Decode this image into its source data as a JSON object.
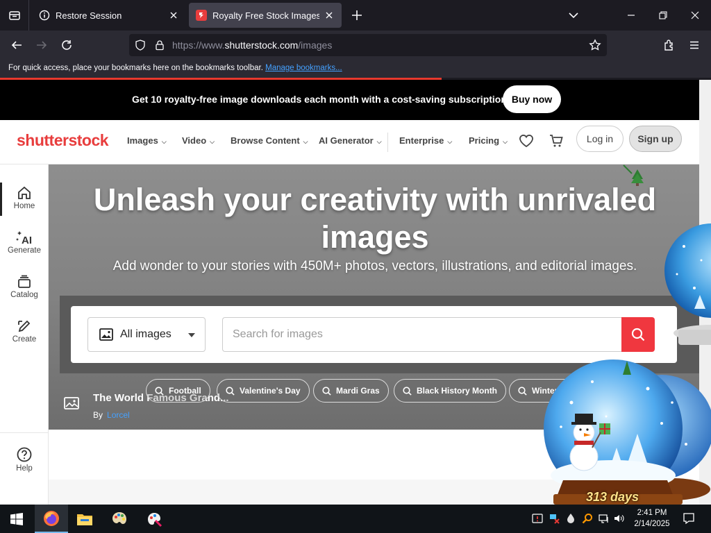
{
  "browser": {
    "tabs": [
      {
        "label": "Restore Session",
        "active": false
      },
      {
        "label": "Royalty Free Stock Images For C",
        "active": true
      }
    ],
    "url_prefix": "https://www.",
    "url_host": "shutterstock.com",
    "url_path": "/images",
    "bookmarks_hint": "For quick access, place your bookmarks here on the bookmarks toolbar.",
    "bookmarks_link": "Manage bookmarks..."
  },
  "promo": {
    "text": "Get 10 royalty-free image downloads each month with a cost-saving subscription.",
    "button": "Buy now"
  },
  "header": {
    "logo": "shutterstock",
    "menu": [
      "Images",
      "Video",
      "Browse Content",
      "AI Generator",
      "Enterprise",
      "Pricing"
    ],
    "login": "Log in",
    "signup": "Sign up"
  },
  "sidebar": {
    "items": [
      "Home",
      "Generate",
      "Catalog",
      "Create"
    ],
    "help": "Help"
  },
  "hero": {
    "title": "Unleash your creativity with unrivaled images",
    "subtitle": "Add wonder to your stories with 450M+ photos, vectors, illustrations, and editorial images.",
    "type_select": "All images",
    "search_placeholder": "Search for images",
    "chips": [
      "Football",
      "Valentine's Day",
      "Mardi Gras",
      "Black History Month",
      "Winter W"
    ],
    "caption_title": "The World Famous Grand...",
    "caption_by": "By",
    "caption_author": "Lorcel"
  },
  "overlay": {
    "days": "313 days"
  },
  "taskbar": {
    "time": "2:41 PM",
    "date": "2/14/2025"
  },
  "colors": {
    "brand_red": "#e83d3d",
    "search_red": "#f0373f",
    "link_blue": "#45a1ff"
  }
}
